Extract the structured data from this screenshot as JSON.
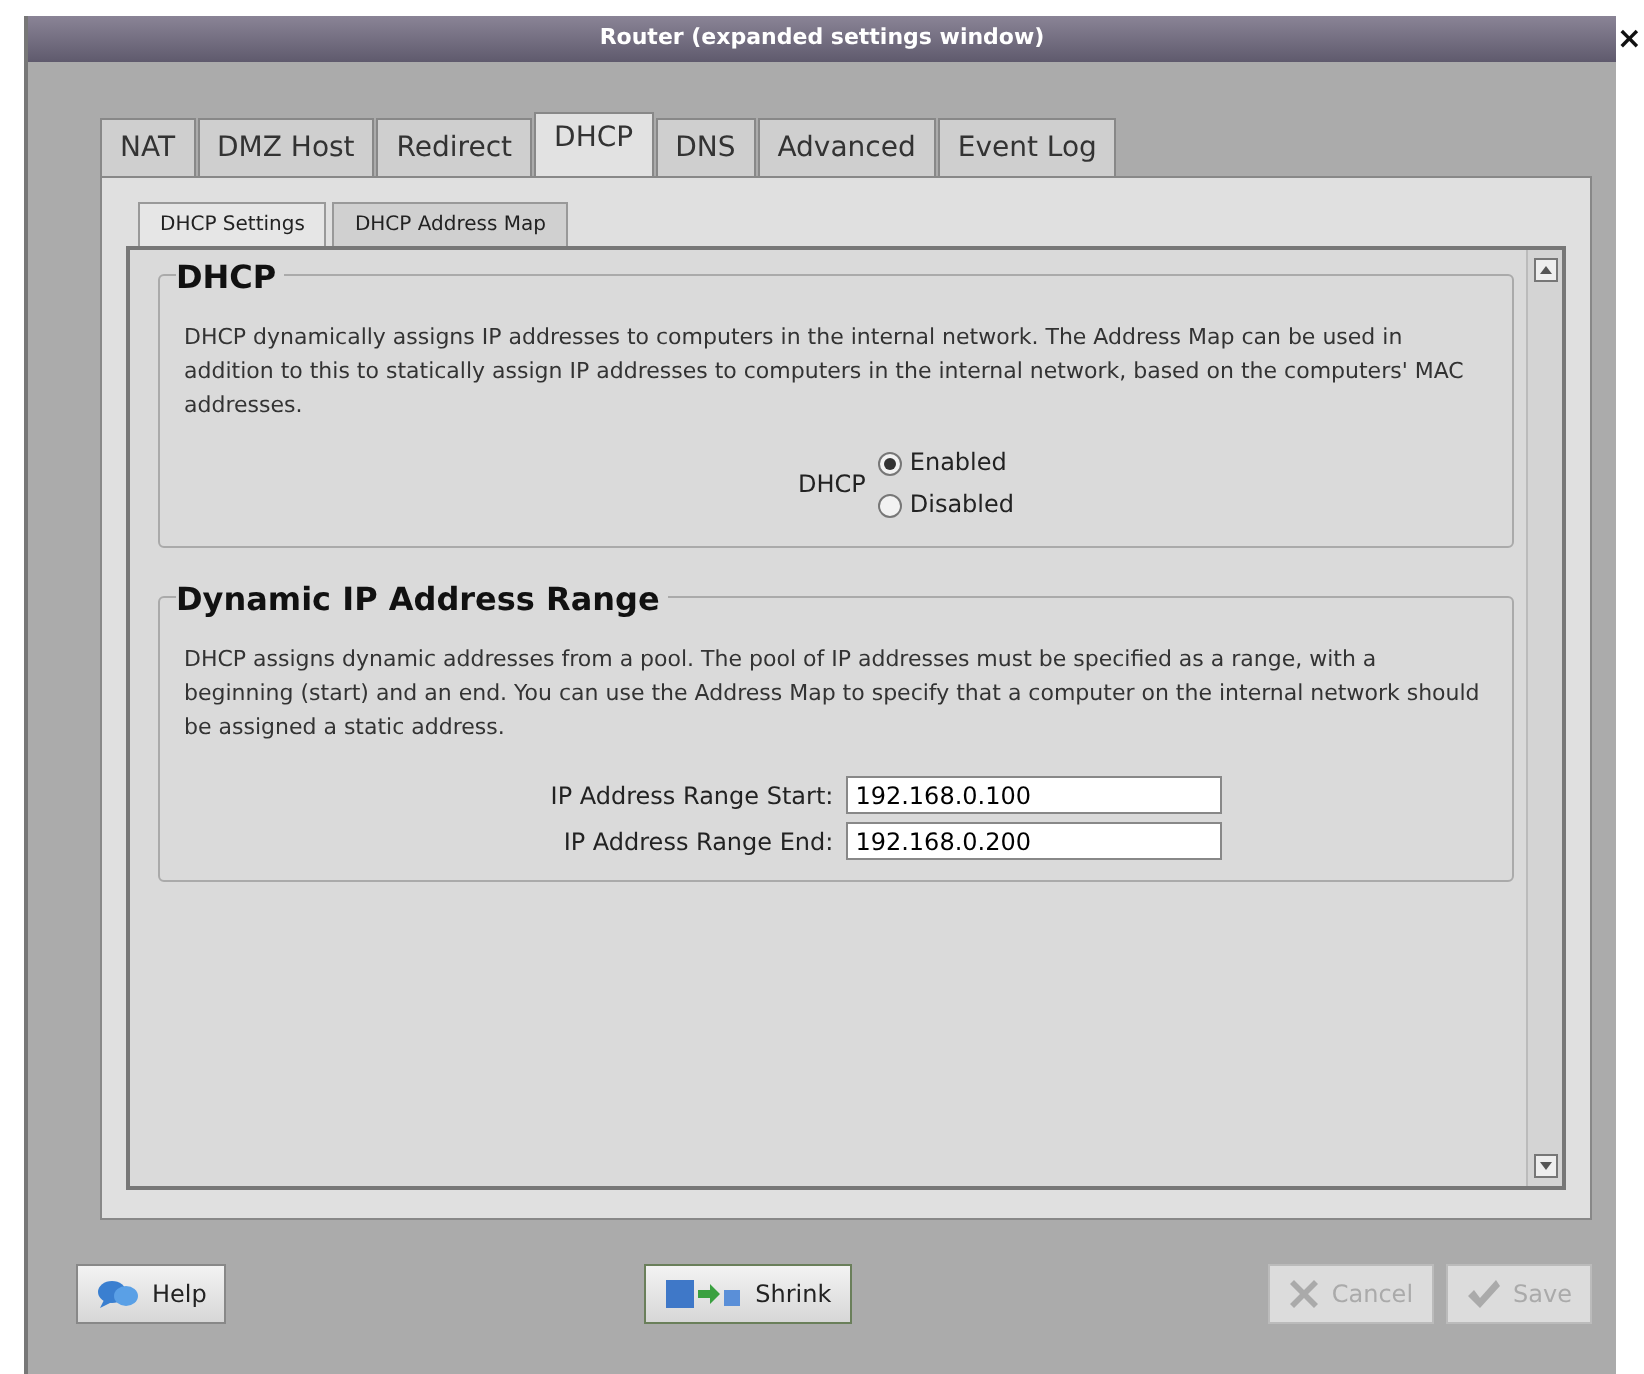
{
  "window": {
    "title": "Router (expanded settings window)",
    "close": "×"
  },
  "tabs": [
    {
      "label": "NAT",
      "selected": false
    },
    {
      "label": "DMZ Host",
      "selected": false
    },
    {
      "label": "Redirect",
      "selected": false
    },
    {
      "label": "DHCP",
      "selected": true
    },
    {
      "label": "DNS",
      "selected": false
    },
    {
      "label": "Advanced",
      "selected": false
    },
    {
      "label": "Event Log",
      "selected": false
    }
  ],
  "subtabs": [
    {
      "label": "DHCP Settings",
      "selected": true
    },
    {
      "label": "DHCP Address Map",
      "selected": false
    }
  ],
  "sections": [
    {
      "kind": "radio",
      "title": "DHCP",
      "description": "DHCP dynamically assigns IP addresses to computers in the internal network.  The Address Map can be used in addition to this to statically assign IP addresses to computers in the internal network, based on the computers' MAC addresses.",
      "label": "DHCP",
      "options": [
        {
          "label": "Enabled",
          "selected": true
        },
        {
          "label": "Disabled",
          "selected": false
        }
      ]
    },
    {
      "kind": "fields",
      "title": "Dynamic IP Address Range",
      "description": "DHCP assigns dynamic addresses from a pool.  The pool of IP addresses must be specified as a range, with a beginning (start) and an end.  You can use the Address Map to specify that a computer on the internal network should be assigned a static address.",
      "fields": [
        {
          "label": "IP Address Range Start:",
          "value": "192.168.0.100"
        },
        {
          "label": "IP Address Range End:",
          "value": "192.168.0.200"
        }
      ]
    }
  ],
  "buttons": [
    {
      "kind": "help",
      "label": "Help",
      "disabled": false
    },
    {
      "kind": "shrink",
      "label": "Shrink",
      "disabled": false
    },
    {
      "kind": "cancel",
      "label": "Cancel",
      "disabled": true
    },
    {
      "kind": "save",
      "label": "Save",
      "disabled": true
    }
  ]
}
